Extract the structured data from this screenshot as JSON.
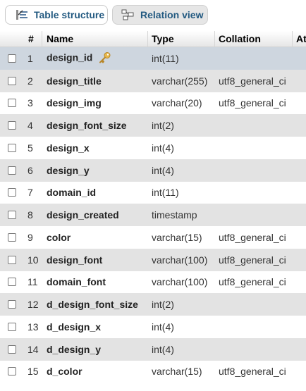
{
  "tabs": [
    {
      "label": "Table structure",
      "icon": "table-structure-icon",
      "active": true
    },
    {
      "label": "Relation view",
      "icon": "relation-view-icon",
      "active": false
    }
  ],
  "table": {
    "headers": [
      "#",
      "Name",
      "Type",
      "Collation",
      "At"
    ],
    "rows": [
      {
        "num": "1",
        "name": "design_id",
        "type": "int(11)",
        "collation": "",
        "primary_key": true
      },
      {
        "num": "2",
        "name": "design_title",
        "type": "varchar(255)",
        "collation": "utf8_general_ci"
      },
      {
        "num": "3",
        "name": "design_img",
        "type": "varchar(20)",
        "collation": "utf8_general_ci"
      },
      {
        "num": "4",
        "name": "design_font_size",
        "type": "int(2)",
        "collation": ""
      },
      {
        "num": "5",
        "name": "design_x",
        "type": "int(4)",
        "collation": ""
      },
      {
        "num": "6",
        "name": "design_y",
        "type": "int(4)",
        "collation": ""
      },
      {
        "num": "7",
        "name": "domain_id",
        "type": "int(11)",
        "collation": ""
      },
      {
        "num": "8",
        "name": "design_created",
        "type": "timestamp",
        "collation": ""
      },
      {
        "num": "9",
        "name": "color",
        "type": "varchar(15)",
        "collation": "utf8_general_ci"
      },
      {
        "num": "10",
        "name": "design_font",
        "type": "varchar(100)",
        "collation": "utf8_general_ci"
      },
      {
        "num": "11",
        "name": "domain_font",
        "type": "varchar(100)",
        "collation": "utf8_general_ci"
      },
      {
        "num": "12",
        "name": "d_design_font_size",
        "type": "int(2)",
        "collation": ""
      },
      {
        "num": "13",
        "name": "d_design_x",
        "type": "int(4)",
        "collation": ""
      },
      {
        "num": "14",
        "name": "d_design_y",
        "type": "int(4)",
        "collation": ""
      },
      {
        "num": "15",
        "name": "d_color",
        "type": "varchar(15)",
        "collation": "utf8_general_ci"
      }
    ]
  },
  "colors": {
    "link": "#235a81",
    "row_even": "#e3e3e3",
    "row_selected": "#ced6df",
    "key_icon": "#e8b84a"
  }
}
